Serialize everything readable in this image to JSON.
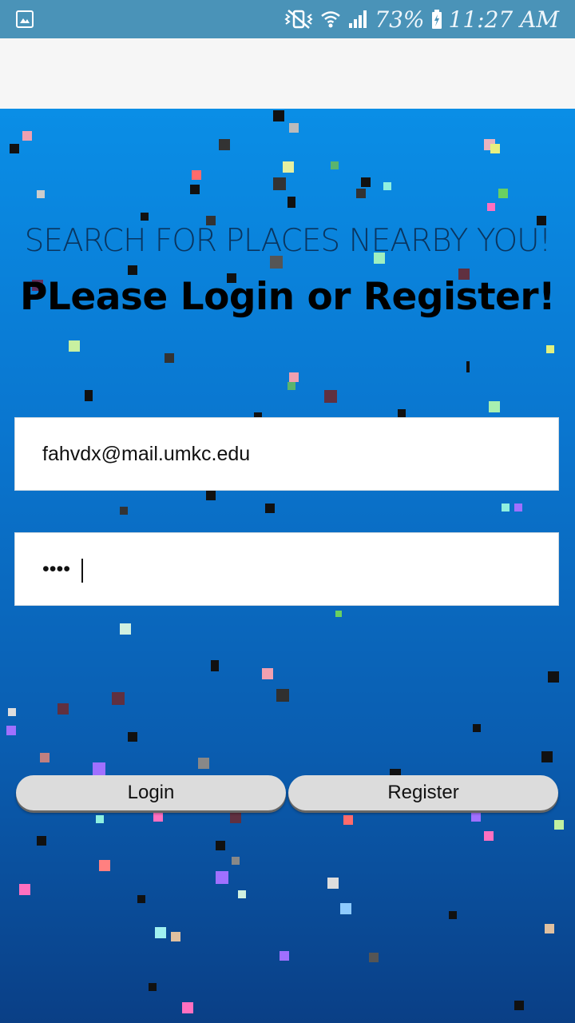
{
  "status_bar": {
    "battery_percent": "73%",
    "time": "11:27 AM",
    "icons": [
      "image-icon",
      "mute-vibrate-icon",
      "wifi-icon",
      "signal-icon",
      "battery-charging-icon"
    ]
  },
  "main": {
    "tagline": "SEARCH FOR PLACES NEARBY YOU!",
    "headline": "PLease Login or Register!",
    "email": {
      "value": "fahvdx@mail.umkc.edu"
    },
    "password": {
      "value": "1234"
    },
    "buttons": {
      "login_label": "Login",
      "register_label": "Register"
    }
  },
  "colors": {
    "status_bar": "#4a93b8",
    "app_bar": "#f6f6f6",
    "background_top": "#0a8ee6",
    "background_bottom": "#0a3f86",
    "button": "#dcdcdc"
  }
}
